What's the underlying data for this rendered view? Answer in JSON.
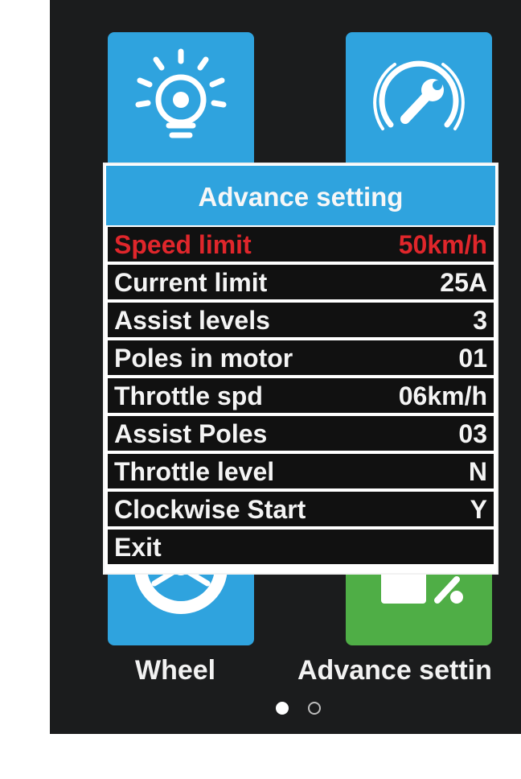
{
  "tiles": [
    {
      "label": "",
      "icon": "light-bulb-icon",
      "color": "#2fa3de"
    },
    {
      "label": "",
      "icon": "speedometer-wrench-icon",
      "color": "#2fa3de"
    },
    {
      "label": "Wheel",
      "icon": "wheel-icon",
      "color": "#2fa3de"
    },
    {
      "label": "Advance settin",
      "icon": "advance-settings-icon",
      "color": "#4fae46"
    }
  ],
  "dialog": {
    "title": "Advance setting",
    "items": [
      {
        "label": "Speed limit",
        "value": "50km/h",
        "selected": true
      },
      {
        "label": "Current limit",
        "value": "25A"
      },
      {
        "label": "Assist levels",
        "value": "3"
      },
      {
        "label": "Poles in motor",
        "value": "01"
      },
      {
        "label": "Throttle spd",
        "value": "06km/h"
      },
      {
        "label": "Assist Poles",
        "value": "03"
      },
      {
        "label": "Throttle level",
        "value": "N"
      },
      {
        "label": "Clockwise Start",
        "value": "Y"
      },
      {
        "label": "Exit",
        "value": ""
      }
    ]
  },
  "pagination": {
    "pages": 2,
    "current": 1
  },
  "colors": {
    "accent": "#2fa3de",
    "green": "#4fae46",
    "selected_text": "#e0262b",
    "screen_bg": "#1b1c1d"
  }
}
